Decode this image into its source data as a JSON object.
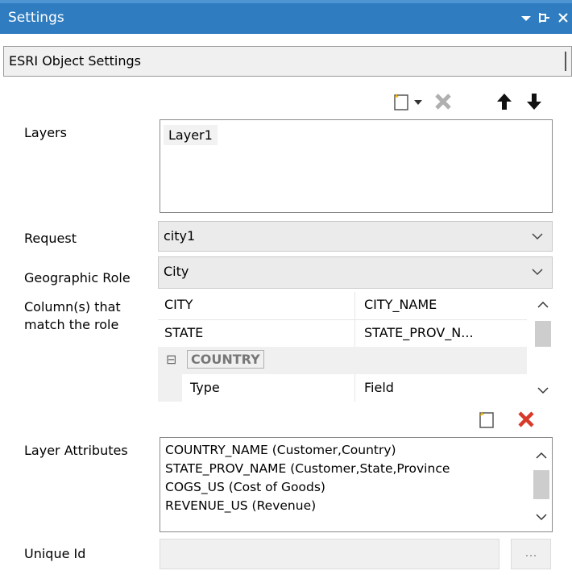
{
  "window": {
    "title": "Settings",
    "controls": [
      "dropdown-icon",
      "pin-icon",
      "close-icon"
    ]
  },
  "section": {
    "title": "ESRI Object Settings"
  },
  "toolbar_layers": [
    "new-layer-icon",
    "dropdown-arrow-icon",
    "delete-layer-icon",
    "move-up-icon",
    "move-down-icon"
  ],
  "labels": {
    "layers": "Layers",
    "request": "Request",
    "geographic_role": "Geographic Role",
    "columns_line1": "Column(s) that",
    "columns_line2": "match the role",
    "layer_attributes": "Layer Attributes",
    "unique_id": "Unique Id"
  },
  "layers": {
    "items": [
      "Layer1"
    ]
  },
  "request": {
    "value": "city1"
  },
  "geographic_role": {
    "value": "City"
  },
  "columns": {
    "rows": [
      {
        "name": "CITY",
        "value": "CITY_NAME"
      },
      {
        "name": "STATE",
        "value": "STATE_PROV_N..."
      }
    ],
    "group": {
      "expander": "⊟",
      "name": "COUNTRY"
    },
    "sub_row": {
      "name": "Type",
      "value": "Field"
    }
  },
  "layer_attributes": {
    "items": [
      "COUNTRY_NAME (Customer,Country)",
      "STATE_PROV_NAME (Customer,State,Province",
      "COGS_US (Cost of Goods)",
      "REVENUE_US (Revenue)"
    ]
  },
  "unique_id": {
    "value": "",
    "button": "..."
  },
  "colors": {
    "titlebar": "#2f7dc0",
    "delete_red": "#d83a2a",
    "combo_bg": "#ebebeb"
  }
}
